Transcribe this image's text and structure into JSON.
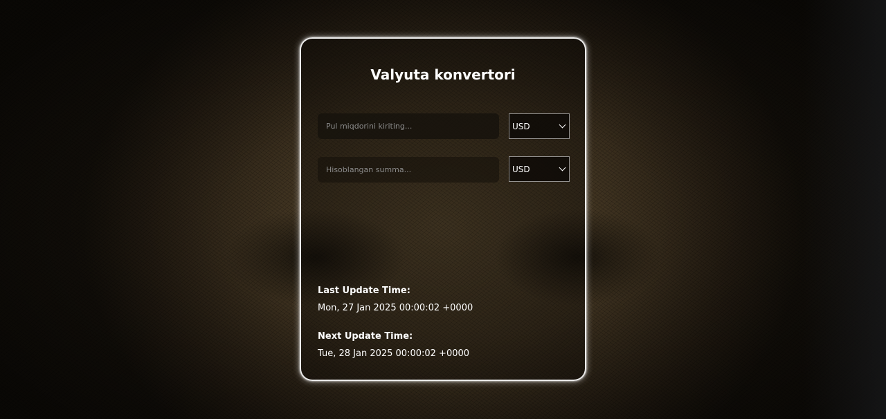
{
  "converter": {
    "title": "Valyuta konvertori",
    "amount": {
      "value": "",
      "placeholder": "Pul miqdorini kiriting..."
    },
    "from_currency": {
      "selected": "USD"
    },
    "result": {
      "value": "",
      "placeholder": "Hisoblangan summa..."
    },
    "to_currency": {
      "selected": "USD"
    }
  },
  "update_info": {
    "last_label": "Last Update Time:",
    "last_value": "Mon, 27 Jan 2025 00:00:02 +0000",
    "next_label": "Next Update Time:",
    "next_value": "Tue, 28 Jan 2025 00:00:02 +0000"
  }
}
